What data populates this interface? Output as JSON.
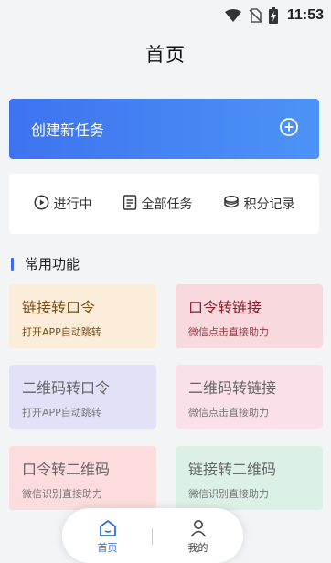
{
  "status_bar": {
    "time": "11:53",
    "icons": [
      "wifi-icon",
      "no-sim-icon",
      "battery-charging-icon"
    ]
  },
  "header": {
    "title": "首页"
  },
  "create_task": {
    "label": "创建新任务",
    "icon": "plus-circle-icon"
  },
  "tabs": [
    {
      "label": "进行中",
      "icon": "play-circle-icon"
    },
    {
      "label": "全部任务",
      "icon": "list-icon"
    },
    {
      "label": "积分记录",
      "icon": "coins-icon"
    }
  ],
  "section": {
    "title": "常用功能",
    "accent": "#3b6de9"
  },
  "features": [
    {
      "title": "链接转口令",
      "subtitle": "打开APP自动跳转",
      "bg": "#fbedd9"
    },
    {
      "title": "口令转链接",
      "subtitle": "微信点击直接助力",
      "bg": "#f8d9dd"
    },
    {
      "title": "二维码转口令",
      "subtitle": "打开APP自动跳转",
      "bg": "#e1e1f7"
    },
    {
      "title": "二维码转链接",
      "subtitle": "微信点击直接助力",
      "bg": "#fbe0ea"
    },
    {
      "title": "口令转二维码",
      "subtitle": "微信识别直接助力",
      "bg": "#fcdcdc"
    },
    {
      "title": "链接转二维码",
      "subtitle": "微信识别直接助力",
      "bg": "#dcf1e5"
    }
  ],
  "bottom_nav": {
    "items": [
      {
        "label": "首页",
        "icon": "home-icon",
        "active": true
      },
      {
        "label": "我的",
        "icon": "person-icon",
        "active": false
      }
    ],
    "active_color": "#2f6be8"
  },
  "colors": {
    "banner_start": "#3d73ef",
    "banner_end": "#4c93f6",
    "background": "#f3f4f6"
  }
}
